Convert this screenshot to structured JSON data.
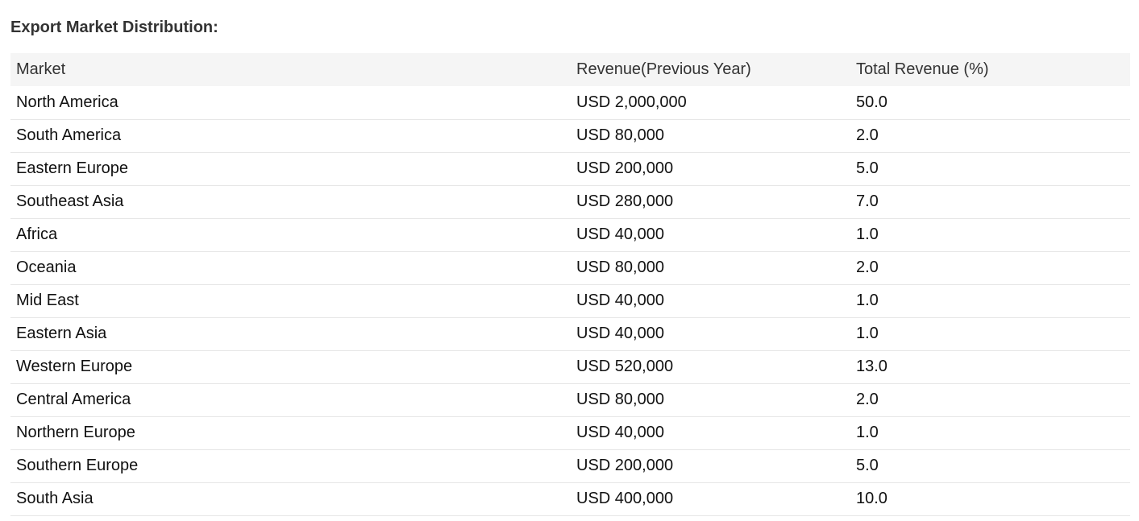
{
  "title": "Export Market Distribution:",
  "table": {
    "headers": [
      "Market",
      "Revenue(Previous Year)",
      "Total Revenue (%)"
    ],
    "rows": [
      {
        "market": "North America",
        "revenue": "USD 2,000,000",
        "percent": "50.0"
      },
      {
        "market": "South America",
        "revenue": "USD 80,000",
        "percent": "2.0"
      },
      {
        "market": "Eastern Europe",
        "revenue": "USD 200,000",
        "percent": "5.0"
      },
      {
        "market": "Southeast Asia",
        "revenue": "USD 280,000",
        "percent": "7.0"
      },
      {
        "market": "Africa",
        "revenue": "USD 40,000",
        "percent": "1.0"
      },
      {
        "market": "Oceania",
        "revenue": "USD 80,000",
        "percent": "2.0"
      },
      {
        "market": "Mid East",
        "revenue": "USD 40,000",
        "percent": "1.0"
      },
      {
        "market": "Eastern Asia",
        "revenue": "USD 40,000",
        "percent": "1.0"
      },
      {
        "market": "Western Europe",
        "revenue": "USD 520,000",
        "percent": "13.0"
      },
      {
        "market": "Central America",
        "revenue": "USD 80,000",
        "percent": "2.0"
      },
      {
        "market": "Northern Europe",
        "revenue": "USD 40,000",
        "percent": "1.0"
      },
      {
        "market": "Southern Europe",
        "revenue": "USD 200,000",
        "percent": "5.0"
      },
      {
        "market": "South Asia",
        "revenue": "USD 400,000",
        "percent": "10.0"
      }
    ]
  },
  "colors": {
    "header_bg": "#f5f5f5",
    "row_divider": "#e6e6e6",
    "text": "#111111"
  }
}
